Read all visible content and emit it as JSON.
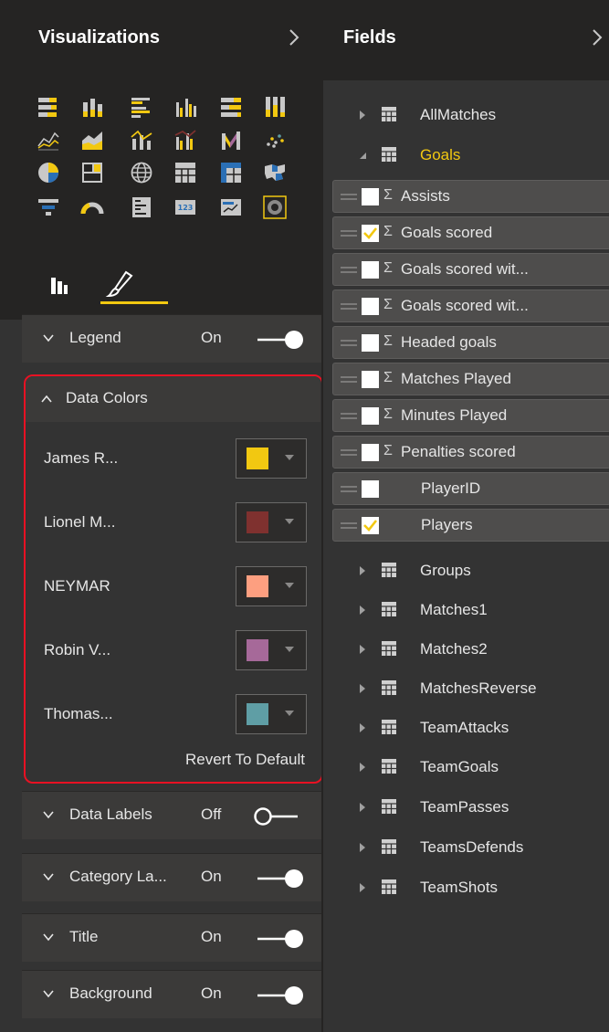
{
  "visualizations": {
    "title": "Visualizations",
    "gallery_icons": [
      "stacked-bar-chart-icon",
      "stacked-column-chart-icon",
      "clustered-bar-chart-icon",
      "clustered-column-chart-icon",
      "100-percent-bar-chart-icon",
      "100-percent-column-chart-icon",
      "line-chart-icon",
      "area-chart-icon",
      "line-column-chart-icon",
      "line-clustered-column-chart-icon",
      "ribbon-chart-icon",
      "scatter-chart-icon",
      "pie-chart-icon",
      "treemap-icon",
      "map-globe-icon",
      "table-icon",
      "matrix-icon",
      "filled-map-icon",
      "funnel-icon",
      "gauge-icon",
      "multi-row-card-icon",
      "card-icon",
      "kpi-icon",
      "slicer-icon"
    ],
    "tabs": {
      "fields_icon": "fields-tab-icon",
      "format_icon": "paintbrush-icon"
    },
    "sections": {
      "legend": {
        "label": "Legend",
        "state": "On"
      },
      "data_colors": {
        "label": "Data Colors",
        "items": [
          {
            "name": "James R...",
            "color": "#f2c811"
          },
          {
            "name": "Lionel M...",
            "color": "#7f312f"
          },
          {
            "name": "NEYMAR",
            "color": "#fd9f80"
          },
          {
            "name": "Robin V...",
            "color": "#a66999"
          },
          {
            "name": "Thomas...",
            "color": "#5f9ea5"
          }
        ],
        "revert_label": "Revert To Default"
      },
      "data_labels": {
        "label": "Data Labels",
        "state": "Off"
      },
      "category_labels": {
        "label": "Category La...",
        "state": "On"
      },
      "title": {
        "label": "Title",
        "state": "On"
      },
      "background": {
        "label": "Background",
        "state": "On"
      }
    },
    "accent_color": "#f2c811",
    "highlight_color": "#e81123"
  },
  "fields": {
    "title": "Fields",
    "tables_top": [
      {
        "name": "AllMatches",
        "expanded": false
      },
      {
        "name": "Goals",
        "expanded": true,
        "highlight": "#f2c811"
      }
    ],
    "goals_fields": [
      {
        "name": "Assists",
        "sigma": true,
        "checked": false
      },
      {
        "name": "Goals scored",
        "sigma": true,
        "checked": true
      },
      {
        "name": "Goals scored wit...",
        "sigma": true,
        "checked": false
      },
      {
        "name": "Goals scored wit...",
        "sigma": true,
        "checked": false
      },
      {
        "name": "Headed goals",
        "sigma": true,
        "checked": false
      },
      {
        "name": "Matches Played",
        "sigma": true,
        "checked": false
      },
      {
        "name": "Minutes Played",
        "sigma": true,
        "checked": false
      },
      {
        "name": "Penalties scored",
        "sigma": true,
        "checked": false
      },
      {
        "name": "PlayerID",
        "sigma": false,
        "checked": false
      },
      {
        "name": "Players",
        "sigma": false,
        "checked": true
      }
    ],
    "sigma_symbol": "Σ",
    "tables_bottom": [
      {
        "name": "Groups"
      },
      {
        "name": "Matches1"
      },
      {
        "name": "Matches2"
      },
      {
        "name": "MatchesReverse"
      },
      {
        "name": "TeamAttacks"
      },
      {
        "name": "TeamGoals"
      },
      {
        "name": "TeamPasses"
      },
      {
        "name": "TeamsDefends"
      },
      {
        "name": "TeamShots"
      }
    ]
  }
}
